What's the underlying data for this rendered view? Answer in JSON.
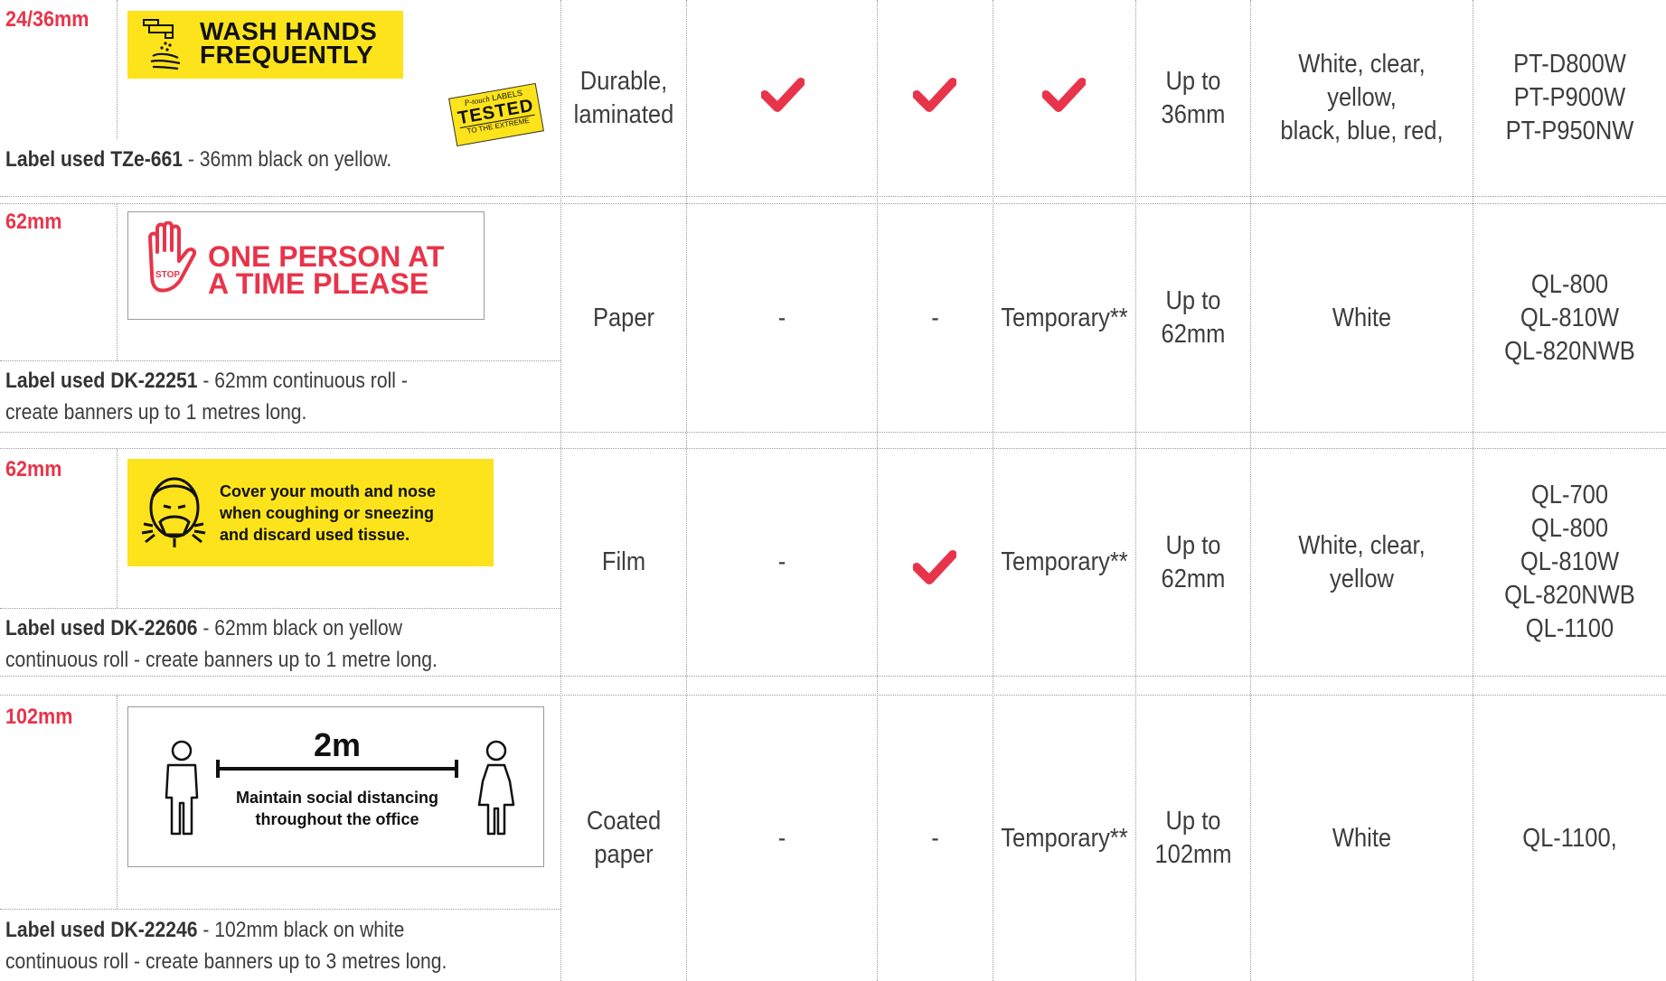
{
  "rows": [
    {
      "size": "24/36mm",
      "label_code": "Label used TZe-661",
      "label_desc": " - 36mm black on yellow.",
      "label_desc2": "",
      "sign_lines": [
        "WASH HANDS",
        "FREQUENTLY"
      ],
      "badge": {
        "brand": "P-touch",
        "small": "LABELS",
        "big": "TESTED",
        "sub": "TO THE EXTREME"
      },
      "material": [
        "Durable,",
        "laminated"
      ],
      "col2": "check",
      "col3": "check",
      "col4": "check",
      "width": [
        "Up to",
        "36mm"
      ],
      "colours": [
        "White, clear, yellow,",
        "black, blue, red,"
      ],
      "models": [
        "PT-D800W",
        "PT-P900W",
        "PT-P950NW"
      ]
    },
    {
      "size": "62mm",
      "label_code": "Label used DK-22251",
      "label_desc": " - 62mm continuous roll  -",
      "label_desc2": "create banners up to 1 metres long.",
      "sign_lines": [
        "ONE PERSON AT",
        "A TIME PLEASE"
      ],
      "stop_text": "STOP",
      "material": [
        "Paper"
      ],
      "col2": "-",
      "col3": "-",
      "col4": "Temporary**",
      "width": [
        "Up to",
        "62mm"
      ],
      "colours": [
        "White"
      ],
      "models": [
        "QL-800",
        "QL-810W",
        "QL-820NWB"
      ]
    },
    {
      "size": "62mm",
      "label_code": "Label used DK-22606",
      "label_desc": " - 62mm black on yellow",
      "label_desc2": "continuous roll - create banners up to 1 metre long.",
      "sign_lines": [
        "Cover your mouth and nose",
        "when coughing or sneezing",
        "and discard used tissue."
      ],
      "material": [
        "Film"
      ],
      "col2": "-",
      "col3": "check",
      "col4": "Temporary**",
      "width": [
        "Up to",
        "62mm"
      ],
      "colours": [
        "White, clear,",
        "yellow"
      ],
      "models": [
        "QL-700",
        "QL-800",
        "QL-810W",
        "QL-820NWB",
        "QL-1100"
      ]
    },
    {
      "size": "102mm",
      "label_code": "Label used DK-22246",
      "label_desc": " - 102mm black on white",
      "label_desc2": "continuous roll - create banners up to 3 metres long.",
      "sign_lines": [
        "2m",
        "Maintain social distancing",
        "throughout the office"
      ],
      "material": [
        "Coated",
        "paper"
      ],
      "col2": "-",
      "col3": "-",
      "col4": "Temporary**",
      "width": [
        "Up to",
        "102mm"
      ],
      "colours": [
        "White"
      ],
      "models": [
        "QL-1100,"
      ]
    }
  ],
  "colors": {
    "accent": "#e8344a",
    "check": "#e8344a",
    "yellow": "#fde31b",
    "text": "#3d3d3d"
  }
}
